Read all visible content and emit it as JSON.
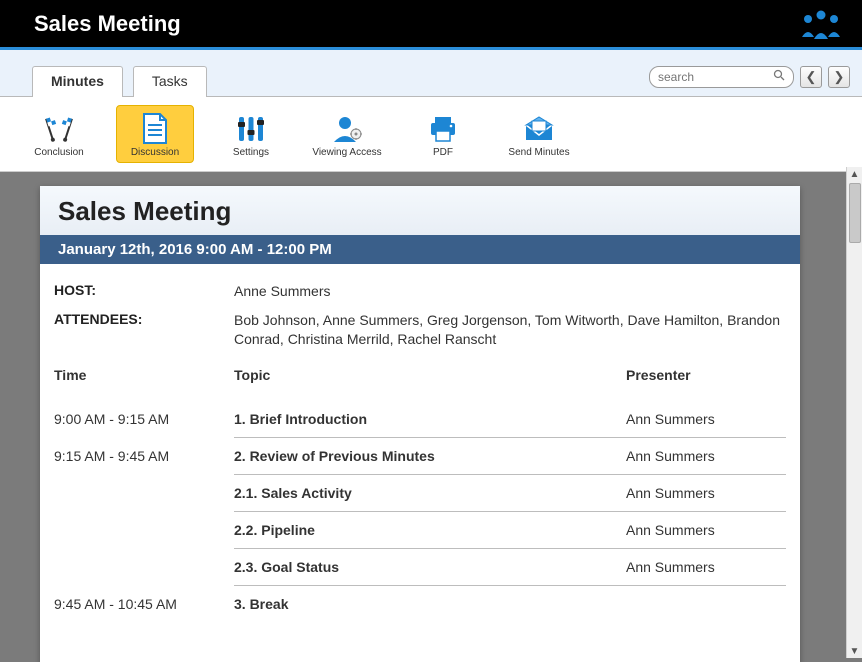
{
  "header": {
    "title": "Sales Meeting"
  },
  "tabs": [
    {
      "label": "Minutes",
      "active": true
    },
    {
      "label": "Tasks",
      "active": false
    }
  ],
  "search": {
    "placeholder": "search"
  },
  "toolbar": {
    "conclusion": "Conclusion",
    "discussion": "Discussion",
    "settings": "Settings",
    "viewing_access": "Viewing Access",
    "pdf": "PDF",
    "send_minutes": "Send Minutes"
  },
  "doc": {
    "title": "Sales Meeting",
    "datetime": "January 12th, 2016  9:00 AM - 12:00 PM",
    "host_label": "HOST:",
    "host_value": "Anne Summers",
    "attendees_label": "ATTENDEES:",
    "attendees_value": "Bob Johnson, Anne Summers, Greg Jorgenson, Tom Witworth, Dave Hamilton, Brandon Conrad, Christina Merrild, Rachel Ranscht",
    "columns": {
      "time": "Time",
      "topic": "Topic",
      "presenter": "Presenter"
    },
    "rows": [
      {
        "time": "9:00 AM - 9:15 AM",
        "topic": "1. Brief Introduction",
        "presenter": "Ann Summers"
      },
      {
        "time": "9:15 AM - 9:45 AM",
        "topic": "2. Review of Previous Minutes",
        "presenter": "Ann Summers"
      },
      {
        "time": "",
        "topic": "2.1. Sales Activity",
        "presenter": "Ann Summers"
      },
      {
        "time": "",
        "topic": "2.2. Pipeline",
        "presenter": "Ann Summers"
      },
      {
        "time": "",
        "topic": "2.3. Goal Status",
        "presenter": "Ann Summers"
      },
      {
        "time": "9:45 AM - 10:45 AM",
        "topic": "3. Break",
        "presenter": ""
      }
    ]
  }
}
